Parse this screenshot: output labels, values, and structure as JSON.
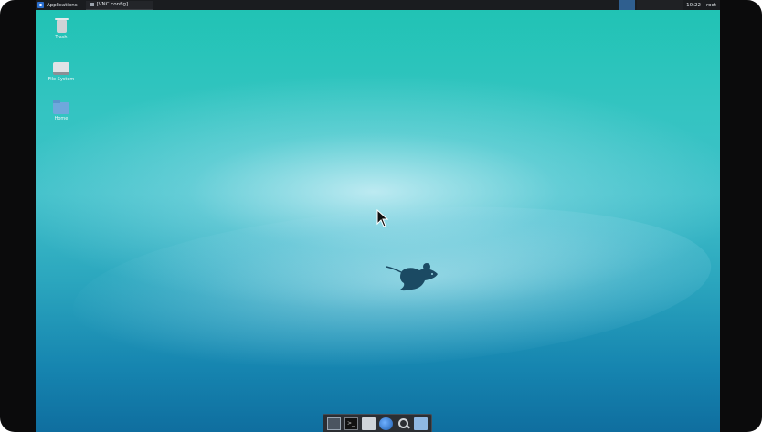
{
  "topbar": {
    "applications_label": "Applications",
    "task_label": "[VNC config]",
    "clock": "10:22",
    "user": "root"
  },
  "desktop_icons": [
    {
      "label": "Trash",
      "icon": "trash-icon"
    },
    {
      "label": "File System",
      "icon": "drive-icon"
    },
    {
      "label": "Home",
      "icon": "home-folder-icon"
    }
  ],
  "dock": {
    "items": [
      {
        "name": "show-desktop",
        "icon": "desktop-icon"
      },
      {
        "name": "terminal",
        "icon": "terminal-icon",
        "glyph": ">_"
      },
      {
        "name": "file-manager",
        "icon": "files-icon"
      },
      {
        "name": "web-browser",
        "icon": "globe-icon"
      },
      {
        "name": "app-finder",
        "icon": "magnifier-icon"
      },
      {
        "name": "folder",
        "icon": "folder-icon"
      }
    ]
  },
  "colors": {
    "panel": "#1a1c1f",
    "wallpaper_top": "#1fc3b3",
    "wallpaper_bottom": "#0f6e9f",
    "mouse_logo": "#1b4a63"
  }
}
